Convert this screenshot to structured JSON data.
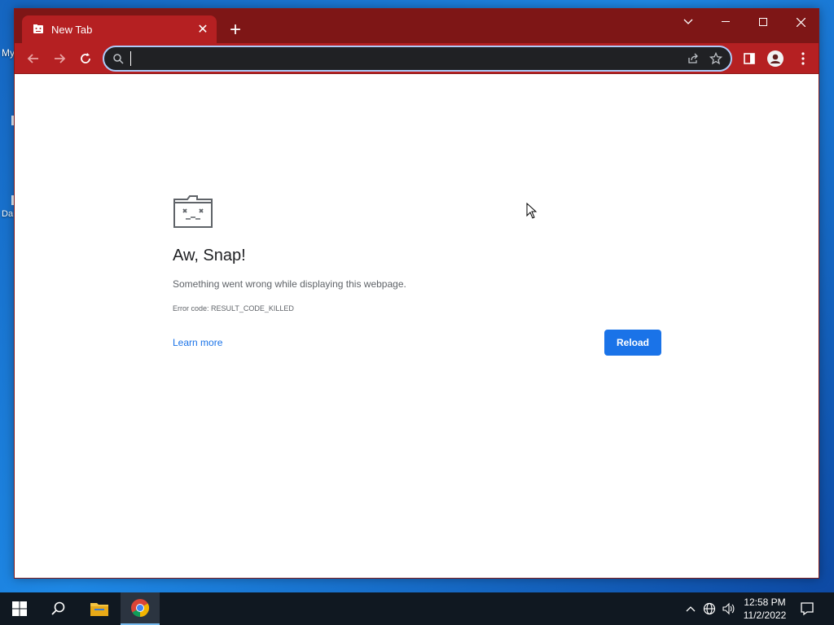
{
  "desktop": {
    "icon1_label": "My",
    "icon2_label": "Da"
  },
  "browser": {
    "tab": {
      "title": "New Tab",
      "close_glyph": "✕"
    },
    "new_tab_glyph": "+",
    "window_controls": {
      "tab_search": "⌄",
      "minimize": "—",
      "maximize": "☐",
      "close": "✕"
    },
    "omnibox": {
      "value": "",
      "placeholder": ""
    },
    "accent_color": "#b52022"
  },
  "error_page": {
    "heading": "Aw, Snap!",
    "description": "Something went wrong while displaying this webpage.",
    "error_code": "Error code: RESULT_CODE_KILLED",
    "learn_more": "Learn more",
    "reload": "Reload"
  },
  "taskbar": {
    "time": "12:58 PM",
    "date": "11/2/2022"
  }
}
